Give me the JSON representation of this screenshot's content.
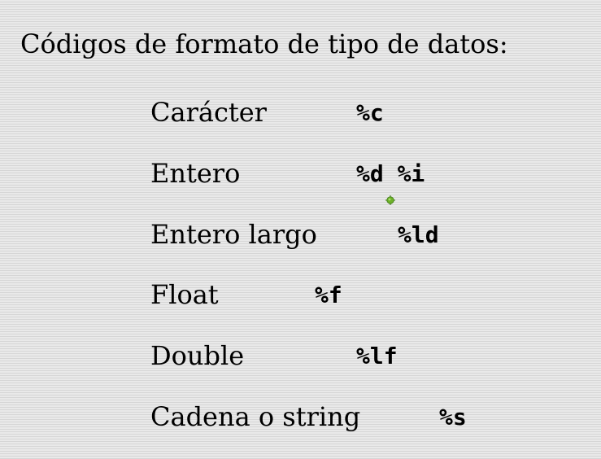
{
  "slide": {
    "title": "Códigos de formato de tipo de datos:",
    "rows": [
      {
        "label": "Carácter",
        "code": "%c"
      },
      {
        "label": "Entero",
        "code": "%d %i"
      },
      {
        "label": "Entero largo",
        "code": "%ld"
      },
      {
        "label": "Float",
        "code": "%f"
      },
      {
        "label": "Double",
        "code": "%lf"
      },
      {
        "label": "Cadena o string",
        "code": "%s"
      }
    ]
  },
  "icons": {
    "pointer": "green-crosshair-pointer-icon"
  },
  "colors": {
    "pointer_fill": "#6fb22a",
    "pointer_dark": "#3d7a12"
  }
}
